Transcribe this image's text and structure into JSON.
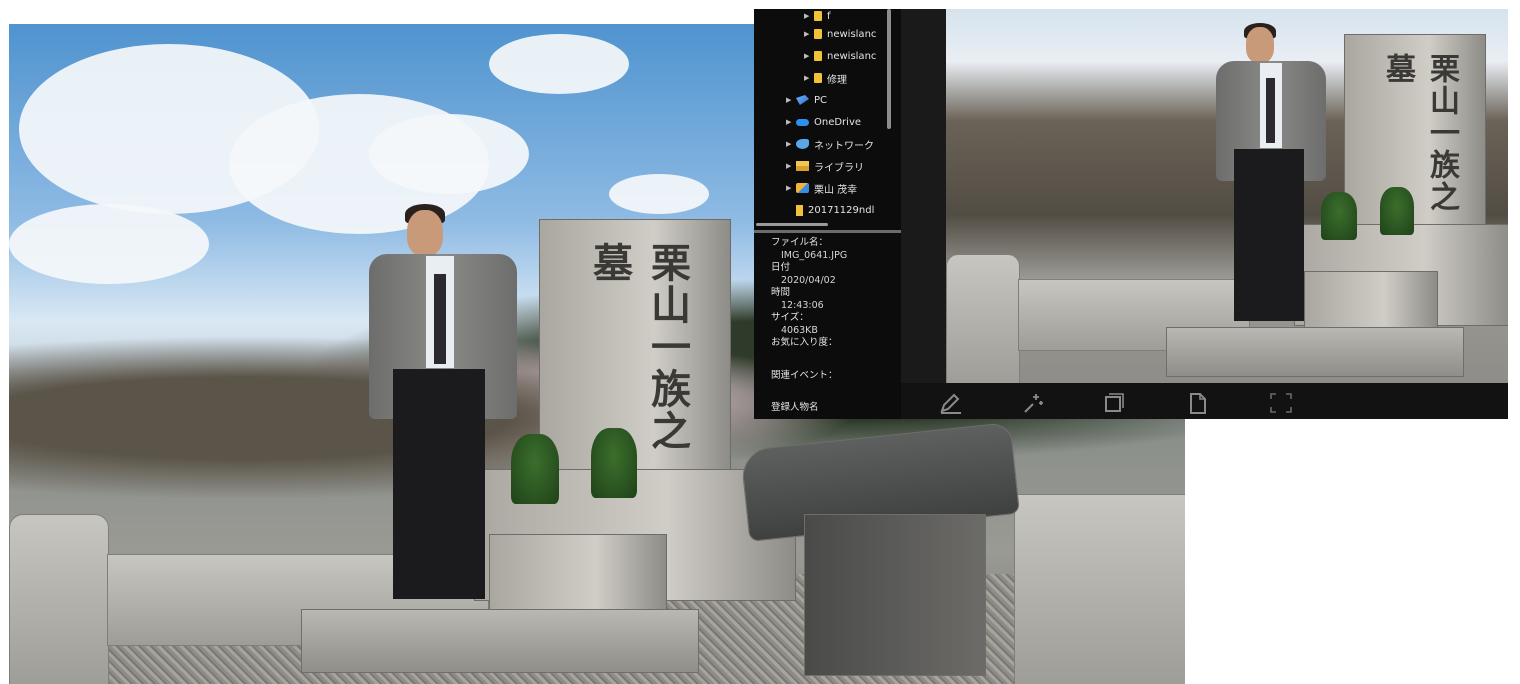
{
  "tree": {
    "items": [
      {
        "label": "f",
        "icon": "folder-icon",
        "indent": 2
      },
      {
        "label": "newislanc",
        "icon": "folder-icon",
        "indent": 2
      },
      {
        "label": "newislanc",
        "icon": "folder-icon",
        "indent": 2
      },
      {
        "label": "修理",
        "icon": "folder-icon",
        "indent": 2
      },
      {
        "label": "PC",
        "icon": "pc-icon",
        "indent": 1
      },
      {
        "label": "OneDrive",
        "icon": "cloud-icon",
        "indent": 1
      },
      {
        "label": "ネットワーク",
        "icon": "network-icon",
        "indent": 1
      },
      {
        "label": "ライブラリ",
        "icon": "library-icon",
        "indent": 1
      },
      {
        "label": "栗山 茂幸",
        "icon": "user-folder-icon",
        "indent": 1
      },
      {
        "label": "20171129ndl",
        "icon": "file-icon",
        "indent": 1
      }
    ]
  },
  "info": {
    "filename_label": "ファイル名：",
    "filename_value": "IMG_0641.JPG",
    "date_label": "日付",
    "date_value": "2020/04/02",
    "time_label": "時間",
    "time_value": "12:43:06",
    "size_label": "サイズ：",
    "size_value": "4063KB",
    "favorite_label": "お気に入り度：",
    "event_label": "関連イベント：",
    "person_label": "登録人物名"
  },
  "photo": {
    "tomb_inscription": "栗山一族之墓"
  },
  "colors": {
    "panel_bg": "#0c0c0c",
    "toolbar_bg": "#121212",
    "folder": "#f0c23a"
  }
}
